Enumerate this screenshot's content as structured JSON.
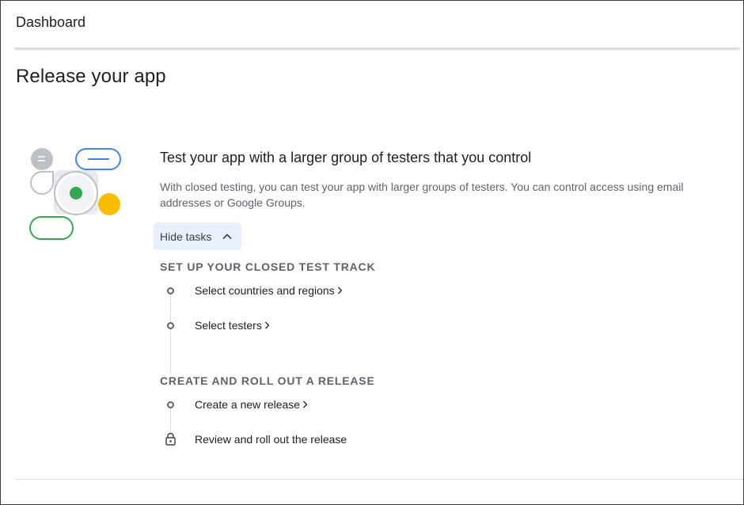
{
  "header": {
    "title": "Dashboard"
  },
  "page": {
    "title": "Release your app"
  },
  "card": {
    "heading": "Test your app with a larger group of testers that you control",
    "description": "With closed testing, you can test your app with larger groups of testers. You can control access using email addresses or Google Groups.",
    "toggle_label": "Hide tasks",
    "illustration_colors": {
      "blue": "#4285f4",
      "green": "#34a853",
      "yellow": "#fbbc04",
      "grey": "#bdc1c6"
    }
  },
  "sections": [
    {
      "heading": "SET UP YOUR CLOSED TEST TRACK",
      "tasks": [
        {
          "label": "Select countries and regions",
          "state": "open"
        },
        {
          "label": "Select testers",
          "state": "open"
        }
      ]
    },
    {
      "heading": "CREATE AND ROLL OUT A RELEASE",
      "tasks": [
        {
          "label": "Create a new release",
          "state": "open"
        },
        {
          "label": "Review and roll out the release",
          "state": "locked"
        }
      ]
    }
  ]
}
